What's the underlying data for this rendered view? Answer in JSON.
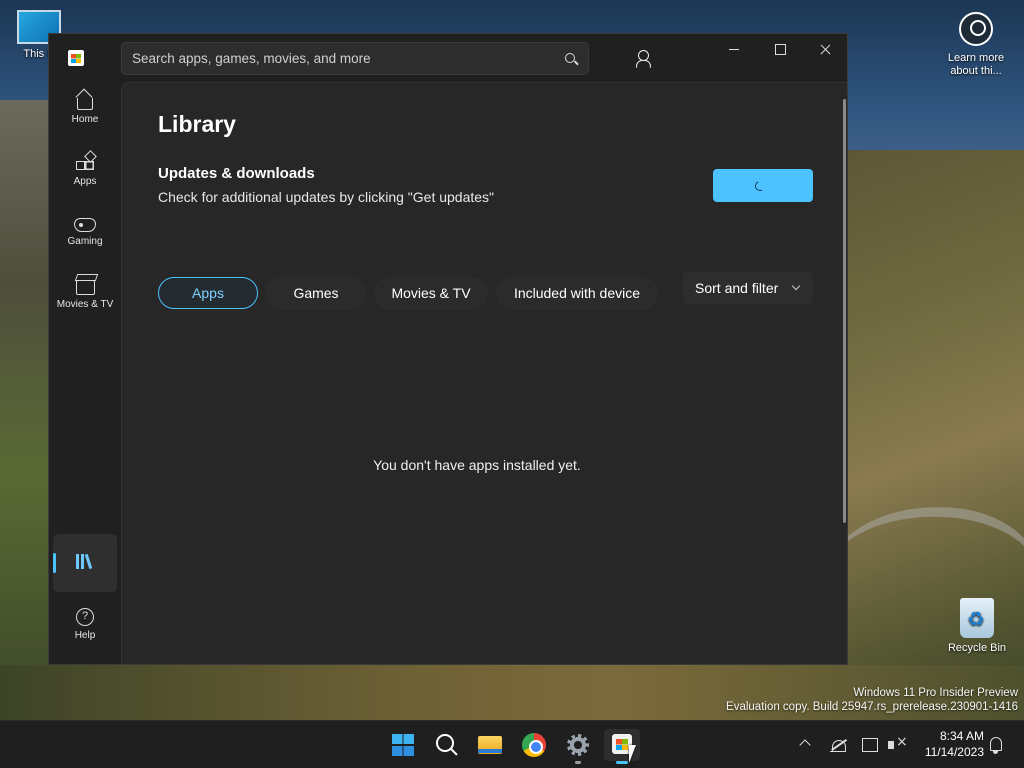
{
  "desktop": {
    "icons": {
      "this_pc": "This P",
      "learn_more": "Learn more about thi...",
      "recycle_bin": "Recycle Bin"
    },
    "watermark": {
      "line1": "Windows 11 Pro Insider Preview",
      "line2": "Evaluation copy. Build 25947.rs_prerelease.230901-1416"
    }
  },
  "store": {
    "search": {
      "placeholder": "Search apps, games, movies, and more"
    },
    "nav": {
      "home": "Home",
      "apps": "Apps",
      "gaming": "Gaming",
      "movies": "Movies & TV",
      "help": "Help"
    },
    "library": {
      "title": "Library",
      "updates_title": "Updates & downloads",
      "updates_desc": "Check for additional updates by clicking \"Get updates\"",
      "filters": [
        "Apps",
        "Games",
        "Movies & TV",
        "Included with device"
      ],
      "active_filter": "Apps",
      "sort_label": "Sort and filter",
      "empty_message": "You don't have apps installed yet."
    },
    "accent_color": "#4cc2ff"
  },
  "taskbar": {
    "time": "8:34 AM",
    "date": "11/14/2023"
  }
}
